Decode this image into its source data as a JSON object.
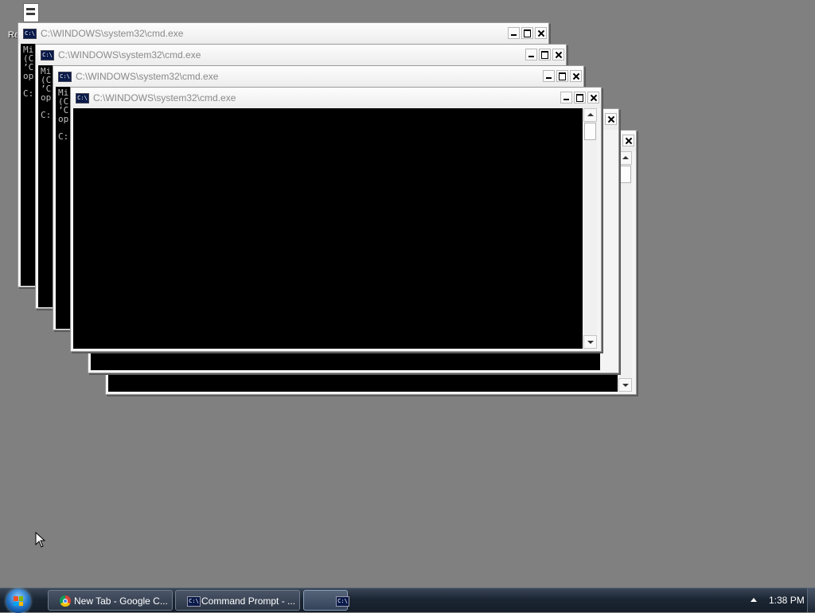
{
  "desktop": {
    "icon_label": "Re",
    "icon_name": "document-icon"
  },
  "windows": [
    {
      "title": "C:\\WINDOWS\\system32\\cmd.exe",
      "console_lines": [
        "Mi",
        "(C",
        "’C",
        "op",
        "",
        "C:"
      ]
    },
    {
      "title": "C:\\WINDOWS\\system32\\cmd.exe",
      "console_lines": [
        "Mi",
        "(C",
        "’C",
        "op",
        "",
        "C:"
      ]
    },
    {
      "title": "C:\\WINDOWS\\system32\\cmd.exe",
      "console_lines": [
        "Mi",
        "(C",
        "’C",
        "op",
        "",
        "C:"
      ]
    },
    {
      "title": "C:\\WINDOWS\\system32\\cmd.exe",
      "console_lines": []
    },
    {
      "title": "",
      "console_lines": []
    },
    {
      "title": "",
      "console_lines": []
    }
  ],
  "console_icon_text": "C:\\",
  "taskbar": {
    "start_label": "Start",
    "buttons": [
      {
        "label": "New Tab - Google C...",
        "icon": "chrome-icon"
      },
      {
        "label": "Command Prompt - ...",
        "icon": "cmd-icon"
      },
      {
        "label": "",
        "icon": "cmd-icon"
      }
    ],
    "clock": "1:38 PM"
  },
  "colors": {
    "desktop_bg": "#808080",
    "console_bg": "#000000",
    "title_text": "#8a8a8a"
  }
}
